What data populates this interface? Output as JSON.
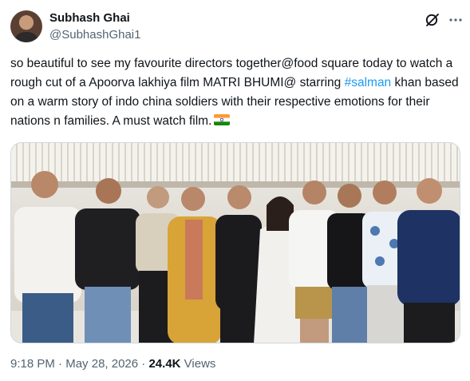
{
  "author": {
    "name": "Subhash Ghai",
    "handle": "@SubhashGhai1"
  },
  "tweet": {
    "text_before": "so beautiful to see my favourite directors together@food square today to watch a rough cut of a Apoorva lakhiya film MATRI BHUMI@ starring ",
    "hashtag": "#salman",
    "text_after": " khan based on a warm story of indo china soldiers with their respective emotions for their nations n families. A must watch film."
  },
  "meta": {
    "time": "9:18 PM",
    "date": "May 28, 2026",
    "views_count": "24.4K",
    "views_label": "Views",
    "separator": " · "
  },
  "icons": {
    "grok": "grok-icon",
    "more": "more-options-icon",
    "flag": "india-flag-icon"
  },
  "colors": {
    "link": "#1d9bf0",
    "secondary_text": "#536471",
    "primary_text": "#0f1419"
  }
}
